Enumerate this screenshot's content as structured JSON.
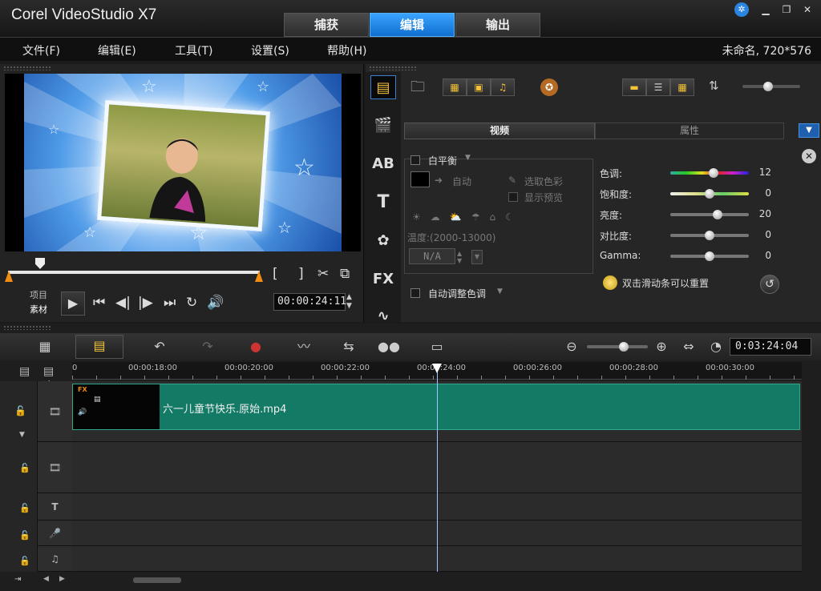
{
  "app": {
    "title": "Corel VideoStudio X7"
  },
  "main_tabs": [
    {
      "label": "捕获"
    },
    {
      "label": "编辑"
    },
    {
      "label": "输出"
    }
  ],
  "menu": {
    "items": [
      {
        "label": "文件(F)"
      },
      {
        "label": "编辑(E)"
      },
      {
        "label": "工具(T)"
      },
      {
        "label": "设置(S)"
      },
      {
        "label": "帮助(H)"
      }
    ],
    "project_info": "未命名, 720*576"
  },
  "preview": {
    "mode_project": "项目",
    "mode_clip": "素材",
    "bracket_open": "[",
    "bracket_close": "]",
    "timecode": "00:00:24:11"
  },
  "library": {
    "side_icons": [
      {
        "name": "media-library-icon",
        "glyph": "▦"
      },
      {
        "name": "instant-project-icon",
        "glyph": "🎬"
      },
      {
        "name": "transition-icon",
        "glyph": "AB"
      },
      {
        "name": "title-icon",
        "glyph": "T"
      },
      {
        "name": "graphic-icon",
        "glyph": "✿"
      },
      {
        "name": "filter-icon",
        "glyph": "FX"
      },
      {
        "name": "path-icon",
        "glyph": "∿"
      }
    ],
    "tabs": {
      "video": "视频",
      "attributes": "属性"
    },
    "white_balance": {
      "label": "白平衡",
      "auto": "自动",
      "pick_color": "选取色彩",
      "show_preview": "显示预览",
      "temperature_label": "温度:(2000-13000)",
      "temperature_value": "N/A"
    },
    "auto_adjust": "自动调整色调",
    "adjust": {
      "items": [
        {
          "label": "色调:",
          "value": "12",
          "level": 0.55
        },
        {
          "label": "饱和度:",
          "value": "0",
          "level": 0.5
        },
        {
          "label": "亮度:",
          "value": "20",
          "level": 0.6
        },
        {
          "label": "对比度:",
          "value": "0",
          "level": 0.5
        },
        {
          "label": "Gamma:",
          "value": "0",
          "level": 0.5
        }
      ],
      "hint": "双击滑动条可以重置"
    }
  },
  "timeline": {
    "timecode": "0:03:24:04",
    "ruler": {
      "labels": [
        "0",
        "00:00:18:00",
        "00:00:20:00",
        "00:00:22:00",
        "00:00:24:00",
        "00:00:26:00",
        "00:00:28:00",
        "00:00:30:00"
      ]
    },
    "add_remove": "+/−",
    "tracks": {
      "video_clip_name": "六一儿童节快乐.原始.mp4",
      "fx_badge": "FX",
      "title_track_label": "T",
      "music_track_label": "♫"
    }
  }
}
